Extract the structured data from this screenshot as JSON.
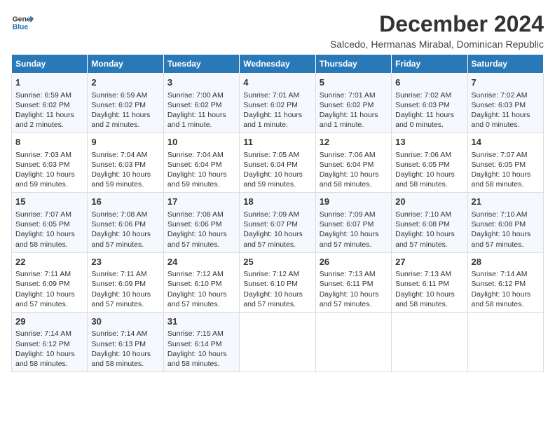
{
  "logo": {
    "line1": "General",
    "line2": "Blue"
  },
  "title": "December 2024",
  "location": "Salcedo, Hermanas Mirabal, Dominican Republic",
  "days_of_week": [
    "Sunday",
    "Monday",
    "Tuesday",
    "Wednesday",
    "Thursday",
    "Friday",
    "Saturday"
  ],
  "weeks": [
    [
      {
        "day": "1",
        "sunrise": "6:59 AM",
        "sunset": "6:02 PM",
        "daylight": "11 hours and 2 minutes."
      },
      {
        "day": "2",
        "sunrise": "6:59 AM",
        "sunset": "6:02 PM",
        "daylight": "11 hours and 2 minutes."
      },
      {
        "day": "3",
        "sunrise": "7:00 AM",
        "sunset": "6:02 PM",
        "daylight": "11 hours and 1 minute."
      },
      {
        "day": "4",
        "sunrise": "7:01 AM",
        "sunset": "6:02 PM",
        "daylight": "11 hours and 1 minute."
      },
      {
        "day": "5",
        "sunrise": "7:01 AM",
        "sunset": "6:02 PM",
        "daylight": "11 hours and 1 minute."
      },
      {
        "day": "6",
        "sunrise": "7:02 AM",
        "sunset": "6:03 PM",
        "daylight": "11 hours and 0 minutes."
      },
      {
        "day": "7",
        "sunrise": "7:02 AM",
        "sunset": "6:03 PM",
        "daylight": "11 hours and 0 minutes."
      }
    ],
    [
      {
        "day": "8",
        "sunrise": "7:03 AM",
        "sunset": "6:03 PM",
        "daylight": "10 hours and 59 minutes."
      },
      {
        "day": "9",
        "sunrise": "7:04 AM",
        "sunset": "6:03 PM",
        "daylight": "10 hours and 59 minutes."
      },
      {
        "day": "10",
        "sunrise": "7:04 AM",
        "sunset": "6:04 PM",
        "daylight": "10 hours and 59 minutes."
      },
      {
        "day": "11",
        "sunrise": "7:05 AM",
        "sunset": "6:04 PM",
        "daylight": "10 hours and 59 minutes."
      },
      {
        "day": "12",
        "sunrise": "7:06 AM",
        "sunset": "6:04 PM",
        "daylight": "10 hours and 58 minutes."
      },
      {
        "day": "13",
        "sunrise": "7:06 AM",
        "sunset": "6:05 PM",
        "daylight": "10 hours and 58 minutes."
      },
      {
        "day": "14",
        "sunrise": "7:07 AM",
        "sunset": "6:05 PM",
        "daylight": "10 hours and 58 minutes."
      }
    ],
    [
      {
        "day": "15",
        "sunrise": "7:07 AM",
        "sunset": "6:05 PM",
        "daylight": "10 hours and 58 minutes."
      },
      {
        "day": "16",
        "sunrise": "7:08 AM",
        "sunset": "6:06 PM",
        "daylight": "10 hours and 57 minutes."
      },
      {
        "day": "17",
        "sunrise": "7:08 AM",
        "sunset": "6:06 PM",
        "daylight": "10 hours and 57 minutes."
      },
      {
        "day": "18",
        "sunrise": "7:09 AM",
        "sunset": "6:07 PM",
        "daylight": "10 hours and 57 minutes."
      },
      {
        "day": "19",
        "sunrise": "7:09 AM",
        "sunset": "6:07 PM",
        "daylight": "10 hours and 57 minutes."
      },
      {
        "day": "20",
        "sunrise": "7:10 AM",
        "sunset": "6:08 PM",
        "daylight": "10 hours and 57 minutes."
      },
      {
        "day": "21",
        "sunrise": "7:10 AM",
        "sunset": "6:08 PM",
        "daylight": "10 hours and 57 minutes."
      }
    ],
    [
      {
        "day": "22",
        "sunrise": "7:11 AM",
        "sunset": "6:09 PM",
        "daylight": "10 hours and 57 minutes."
      },
      {
        "day": "23",
        "sunrise": "7:11 AM",
        "sunset": "6:09 PM",
        "daylight": "10 hours and 57 minutes."
      },
      {
        "day": "24",
        "sunrise": "7:12 AM",
        "sunset": "6:10 PM",
        "daylight": "10 hours and 57 minutes."
      },
      {
        "day": "25",
        "sunrise": "7:12 AM",
        "sunset": "6:10 PM",
        "daylight": "10 hours and 57 minutes."
      },
      {
        "day": "26",
        "sunrise": "7:13 AM",
        "sunset": "6:11 PM",
        "daylight": "10 hours and 57 minutes."
      },
      {
        "day": "27",
        "sunrise": "7:13 AM",
        "sunset": "6:11 PM",
        "daylight": "10 hours and 58 minutes."
      },
      {
        "day": "28",
        "sunrise": "7:14 AM",
        "sunset": "6:12 PM",
        "daylight": "10 hours and 58 minutes."
      }
    ],
    [
      {
        "day": "29",
        "sunrise": "7:14 AM",
        "sunset": "6:12 PM",
        "daylight": "10 hours and 58 minutes."
      },
      {
        "day": "30",
        "sunrise": "7:14 AM",
        "sunset": "6:13 PM",
        "daylight": "10 hours and 58 minutes."
      },
      {
        "day": "31",
        "sunrise": "7:15 AM",
        "sunset": "6:14 PM",
        "daylight": "10 hours and 58 minutes."
      },
      null,
      null,
      null,
      null
    ]
  ]
}
